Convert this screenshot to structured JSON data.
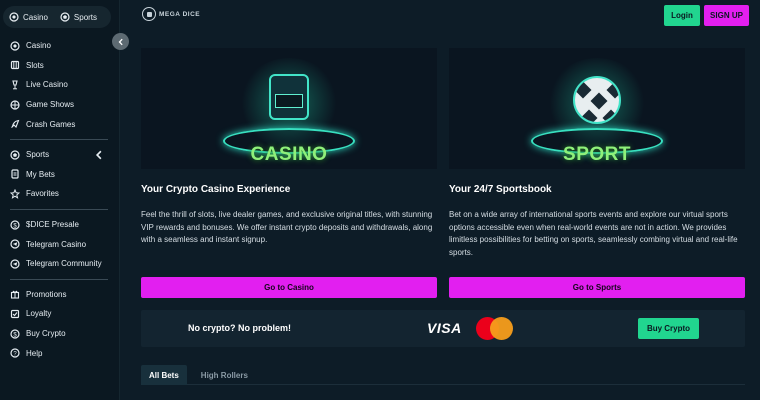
{
  "sidebar": {
    "modes": [
      {
        "label": "Casino",
        "icon": "casino-chip-icon"
      },
      {
        "label": "Sports",
        "icon": "sports-ball-icon"
      }
    ],
    "casino_items": [
      {
        "label": "Casino",
        "icon": "casino-chip-icon"
      },
      {
        "label": "Slots",
        "icon": "slots-icon"
      },
      {
        "label": "Live Casino",
        "icon": "live-casino-icon"
      },
      {
        "label": "Game Shows",
        "icon": "game-shows-icon"
      },
      {
        "label": "Crash Games",
        "icon": "rocket-icon"
      }
    ],
    "sports_items": [
      {
        "label": "Sports",
        "icon": "sports-ball-icon"
      },
      {
        "label": "My Bets",
        "icon": "bets-icon"
      },
      {
        "label": "Favorites",
        "icon": "star-icon"
      }
    ],
    "community_items": [
      {
        "label": "$DICE Presale",
        "icon": "coin-icon"
      },
      {
        "label": "Telegram Casino",
        "icon": "telegram-icon"
      },
      {
        "label": "Telegram Community",
        "icon": "telegram-icon"
      }
    ],
    "extra_items": [
      {
        "label": "Promotions",
        "icon": "gift-icon"
      },
      {
        "label": "Loyalty",
        "icon": "loyalty-icon"
      },
      {
        "label": "Buy Crypto",
        "icon": "dollar-icon"
      },
      {
        "label": "Help",
        "icon": "help-icon"
      }
    ]
  },
  "header": {
    "logo_text": "MEGA DICE",
    "login_label": "Login",
    "signup_label": "SIGN UP"
  },
  "cards": {
    "casino": {
      "hero_text": "CASINO",
      "heading": "Your Crypto Casino Experience",
      "text": "Feel the thrill of slots, live dealer games, and exclusive original titles, with stunning VIP rewards and bonuses. We offer instant crypto deposits and withdrawals, along with a seamless and instant signup.",
      "button": "Go to Casino"
    },
    "sport": {
      "hero_text": "SPORT",
      "heading": "Your 24/7 Sportsbook",
      "text": "Bet on a wide array of international sports events and explore our virtual sports options accessible even when real-world events are not in action. We provides limitless possibilities for betting on sports, seamlessly combing virtual and real-life sports.",
      "button": "Go to Sports"
    }
  },
  "promo": {
    "text": "No crypto? No problem!",
    "visa": "VISA",
    "button": "Buy Crypto"
  },
  "tabs": [
    "All Bets",
    "High Rollers"
  ],
  "colors": {
    "accent_green": "#21d58f",
    "accent_magenta": "#e21ff0",
    "background": "#0d1c27"
  }
}
